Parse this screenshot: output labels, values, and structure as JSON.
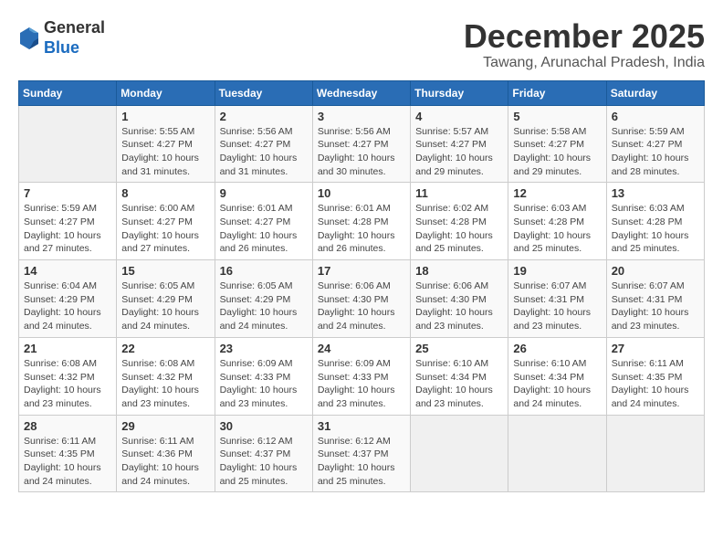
{
  "header": {
    "logo_general": "General",
    "logo_blue": "Blue",
    "month_title": "December 2025",
    "location": "Tawang, Arunachal Pradesh, India"
  },
  "days_of_week": [
    "Sunday",
    "Monday",
    "Tuesday",
    "Wednesday",
    "Thursday",
    "Friday",
    "Saturday"
  ],
  "weeks": [
    [
      {
        "day": "",
        "info": ""
      },
      {
        "day": "1",
        "info": "Sunrise: 5:55 AM\nSunset: 4:27 PM\nDaylight: 10 hours\nand 31 minutes."
      },
      {
        "day": "2",
        "info": "Sunrise: 5:56 AM\nSunset: 4:27 PM\nDaylight: 10 hours\nand 31 minutes."
      },
      {
        "day": "3",
        "info": "Sunrise: 5:56 AM\nSunset: 4:27 PM\nDaylight: 10 hours\nand 30 minutes."
      },
      {
        "day": "4",
        "info": "Sunrise: 5:57 AM\nSunset: 4:27 PM\nDaylight: 10 hours\nand 29 minutes."
      },
      {
        "day": "5",
        "info": "Sunrise: 5:58 AM\nSunset: 4:27 PM\nDaylight: 10 hours\nand 29 minutes."
      },
      {
        "day": "6",
        "info": "Sunrise: 5:59 AM\nSunset: 4:27 PM\nDaylight: 10 hours\nand 28 minutes."
      }
    ],
    [
      {
        "day": "7",
        "info": "Sunrise: 5:59 AM\nSunset: 4:27 PM\nDaylight: 10 hours\nand 27 minutes."
      },
      {
        "day": "8",
        "info": "Sunrise: 6:00 AM\nSunset: 4:27 PM\nDaylight: 10 hours\nand 27 minutes."
      },
      {
        "day": "9",
        "info": "Sunrise: 6:01 AM\nSunset: 4:27 PM\nDaylight: 10 hours\nand 26 minutes."
      },
      {
        "day": "10",
        "info": "Sunrise: 6:01 AM\nSunset: 4:28 PM\nDaylight: 10 hours\nand 26 minutes."
      },
      {
        "day": "11",
        "info": "Sunrise: 6:02 AM\nSunset: 4:28 PM\nDaylight: 10 hours\nand 25 minutes."
      },
      {
        "day": "12",
        "info": "Sunrise: 6:03 AM\nSunset: 4:28 PM\nDaylight: 10 hours\nand 25 minutes."
      },
      {
        "day": "13",
        "info": "Sunrise: 6:03 AM\nSunset: 4:28 PM\nDaylight: 10 hours\nand 25 minutes."
      }
    ],
    [
      {
        "day": "14",
        "info": "Sunrise: 6:04 AM\nSunset: 4:29 PM\nDaylight: 10 hours\nand 24 minutes."
      },
      {
        "day": "15",
        "info": "Sunrise: 6:05 AM\nSunset: 4:29 PM\nDaylight: 10 hours\nand 24 minutes."
      },
      {
        "day": "16",
        "info": "Sunrise: 6:05 AM\nSunset: 4:29 PM\nDaylight: 10 hours\nand 24 minutes."
      },
      {
        "day": "17",
        "info": "Sunrise: 6:06 AM\nSunset: 4:30 PM\nDaylight: 10 hours\nand 24 minutes."
      },
      {
        "day": "18",
        "info": "Sunrise: 6:06 AM\nSunset: 4:30 PM\nDaylight: 10 hours\nand 23 minutes."
      },
      {
        "day": "19",
        "info": "Sunrise: 6:07 AM\nSunset: 4:31 PM\nDaylight: 10 hours\nand 23 minutes."
      },
      {
        "day": "20",
        "info": "Sunrise: 6:07 AM\nSunset: 4:31 PM\nDaylight: 10 hours\nand 23 minutes."
      }
    ],
    [
      {
        "day": "21",
        "info": "Sunrise: 6:08 AM\nSunset: 4:32 PM\nDaylight: 10 hours\nand 23 minutes."
      },
      {
        "day": "22",
        "info": "Sunrise: 6:08 AM\nSunset: 4:32 PM\nDaylight: 10 hours\nand 23 minutes."
      },
      {
        "day": "23",
        "info": "Sunrise: 6:09 AM\nSunset: 4:33 PM\nDaylight: 10 hours\nand 23 minutes."
      },
      {
        "day": "24",
        "info": "Sunrise: 6:09 AM\nSunset: 4:33 PM\nDaylight: 10 hours\nand 23 minutes."
      },
      {
        "day": "25",
        "info": "Sunrise: 6:10 AM\nSunset: 4:34 PM\nDaylight: 10 hours\nand 23 minutes."
      },
      {
        "day": "26",
        "info": "Sunrise: 6:10 AM\nSunset: 4:34 PM\nDaylight: 10 hours\nand 24 minutes."
      },
      {
        "day": "27",
        "info": "Sunrise: 6:11 AM\nSunset: 4:35 PM\nDaylight: 10 hours\nand 24 minutes."
      }
    ],
    [
      {
        "day": "28",
        "info": "Sunrise: 6:11 AM\nSunset: 4:35 PM\nDaylight: 10 hours\nand 24 minutes."
      },
      {
        "day": "29",
        "info": "Sunrise: 6:11 AM\nSunset: 4:36 PM\nDaylight: 10 hours\nand 24 minutes."
      },
      {
        "day": "30",
        "info": "Sunrise: 6:12 AM\nSunset: 4:37 PM\nDaylight: 10 hours\nand 25 minutes."
      },
      {
        "day": "31",
        "info": "Sunrise: 6:12 AM\nSunset: 4:37 PM\nDaylight: 10 hours\nand 25 minutes."
      },
      {
        "day": "",
        "info": ""
      },
      {
        "day": "",
        "info": ""
      },
      {
        "day": "",
        "info": ""
      }
    ]
  ]
}
